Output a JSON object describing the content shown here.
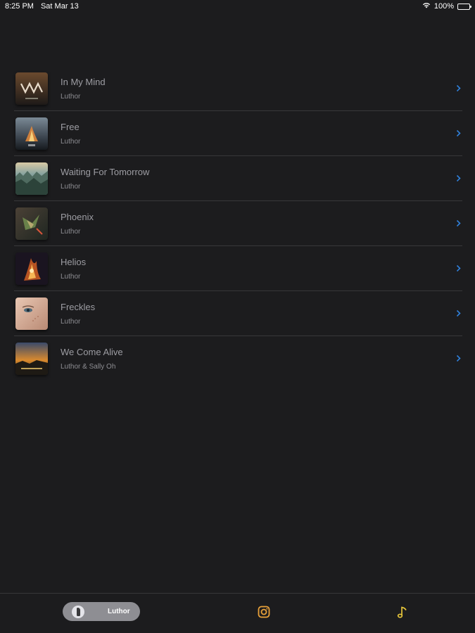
{
  "status_bar": {
    "time": "8:25 PM",
    "date": "Sat Mar 13",
    "battery": "100%",
    "wifi_icon": "wifi-icon",
    "battery_icon": "battery-icon"
  },
  "songs": [
    {
      "title": "In My Mind",
      "artist": "Luthor",
      "art": "album-art-in-my-mind"
    },
    {
      "title": "Free",
      "artist": "Luthor",
      "art": "album-art-free"
    },
    {
      "title": "Waiting For Tomorrow",
      "artist": "Luthor",
      "art": "album-art-waiting-for-tomorrow"
    },
    {
      "title": "Phoenix",
      "artist": "Luthor",
      "art": "album-art-phoenix"
    },
    {
      "title": "Helios",
      "artist": "Luthor",
      "art": "album-art-helios"
    },
    {
      "title": "Freckles",
      "artist": "Luthor",
      "art": "album-art-freckles"
    },
    {
      "title": "We Come Alive",
      "artist": "Luthor & Sally Oh",
      "art": "album-art-we-come-alive"
    }
  ],
  "tab_bar": {
    "luthor_label": "Luthor",
    "instagram_icon": "instagram-icon",
    "music_icon": "music-note-icon"
  },
  "colors": {
    "background": "#1c1c1e",
    "separator": "#38383a",
    "chevron": "#2f7fd9",
    "accent_orange": "#e8a13a",
    "accent_yellow": "#e6c53a",
    "title_text": "#9d9da3"
  }
}
